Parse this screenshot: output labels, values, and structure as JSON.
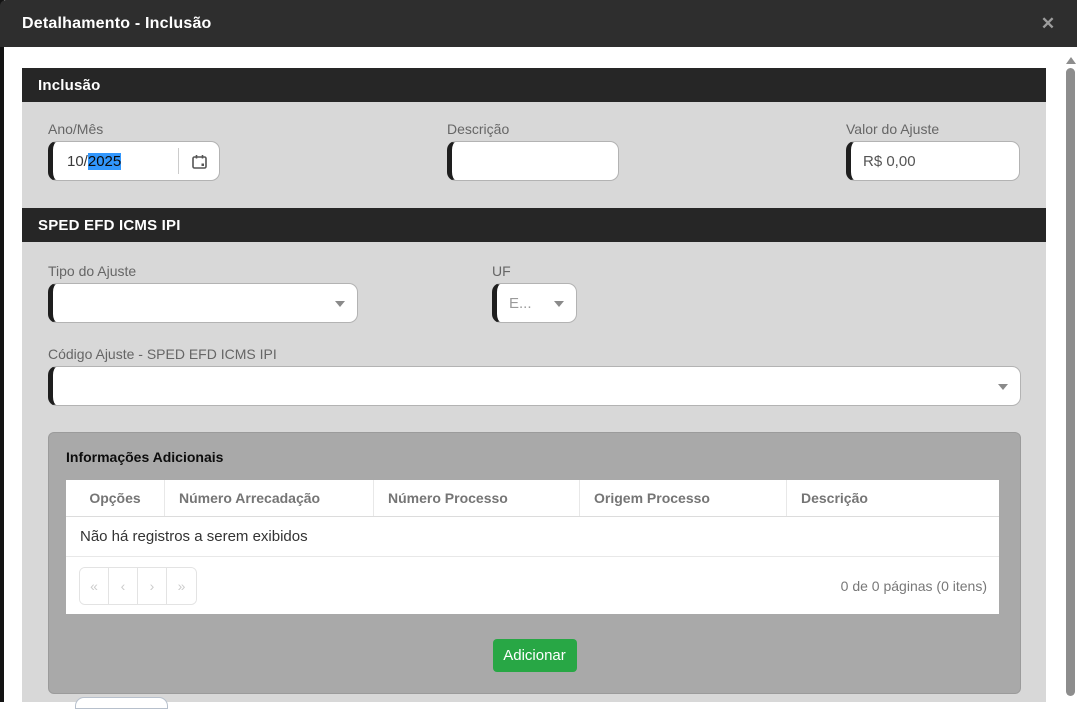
{
  "modal": {
    "title": "Detalhamento - Inclusão",
    "close_glyph": "✕"
  },
  "inclusao": {
    "title": "Inclusão",
    "ano_mes_label": "Ano/Mês",
    "ano_mes_value_prefix": "10/",
    "ano_mes_value_selected": "2025",
    "descricao_label": "Descrição",
    "descricao_value": "",
    "valor_label": "Valor do Ajuste",
    "valor_value": "R$ 0,00"
  },
  "sped": {
    "title": "SPED EFD ICMS IPI",
    "tipo_label": "Tipo do Ajuste",
    "tipo_value": "",
    "uf_label": "UF",
    "uf_value": "E...",
    "codigo_label": "Código Ajuste - SPED EFD ICMS IPI",
    "codigo_value": ""
  },
  "info_panel": {
    "title": "Informações Adicionais",
    "columns": [
      "Opções",
      "Número Arrecadação",
      "Número Processo",
      "Origem Processo",
      "Descrição"
    ],
    "empty_message": "Não há registros a serem exibidos",
    "pagination": {
      "first_glyph": "«",
      "prev_glyph": "‹",
      "next_glyph": "›",
      "last_glyph": "»",
      "summary": "0 de 0 páginas (0 itens)"
    },
    "add_button_label": "Adicionar"
  },
  "colors": {
    "titlebar_bg": "#2e2e2e",
    "section_header_bg": "#262626",
    "section_body_bg": "#d8d8d8",
    "panel_bg": "#a9a9a9",
    "add_button_green": "#28a745",
    "selection_blue": "#3297fd"
  }
}
